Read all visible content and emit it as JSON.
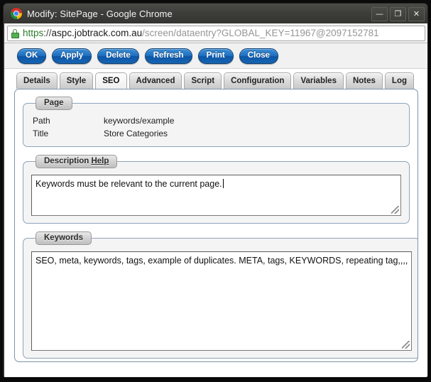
{
  "window": {
    "title": "Modify: SitePage - Google Chrome",
    "icon": "chrome-logo-icon",
    "controls": {
      "minimize": "—",
      "maximize": "❐",
      "close": "✕"
    }
  },
  "urlbar": {
    "lock_icon": "lock-icon",
    "scheme": "https",
    "separator": "://",
    "host": "aspc.jobtrack.com.au",
    "path": "/screen/dataentry?GLOBAL_KEY=11967@2097152781",
    "full_url": "https://aspc.jobtrack.com.au/screen/dataentry?GLOBAL_KEY=11967@2097152781"
  },
  "toolbar": {
    "buttons": [
      {
        "label": "OK"
      },
      {
        "label": "Apply"
      },
      {
        "label": "Delete"
      },
      {
        "label": "Refresh"
      },
      {
        "label": "Print"
      },
      {
        "label": "Close"
      }
    ],
    "accent_color": "#1f6fc0"
  },
  "tabs": {
    "active": "SEO",
    "items": [
      {
        "label": "Details",
        "active": false
      },
      {
        "label": "Style",
        "active": false
      },
      {
        "label": "SEO",
        "active": true
      },
      {
        "label": "Advanced",
        "active": false
      },
      {
        "label": "Script",
        "active": false
      },
      {
        "label": "Configuration",
        "active": false
      },
      {
        "label": "Variables",
        "active": false
      },
      {
        "label": "Notes",
        "active": false
      },
      {
        "label": "Log",
        "active": false
      }
    ]
  },
  "page_group": {
    "legend": "Page",
    "rows": [
      {
        "label": "Path",
        "value": "keywords/example"
      },
      {
        "label": "Title",
        "value": "Store Categories"
      }
    ]
  },
  "description_group": {
    "legend_main": "Description",
    "legend_link": "Help",
    "value": "Keywords must be relevant to the current page.",
    "placeholder": ""
  },
  "keywords_group": {
    "legend": "Keywords",
    "value": "SEO, meta, keywords, tags, example of duplicates. META, tags, KEYWORDS, repeating tag,,,,",
    "placeholder": ""
  }
}
